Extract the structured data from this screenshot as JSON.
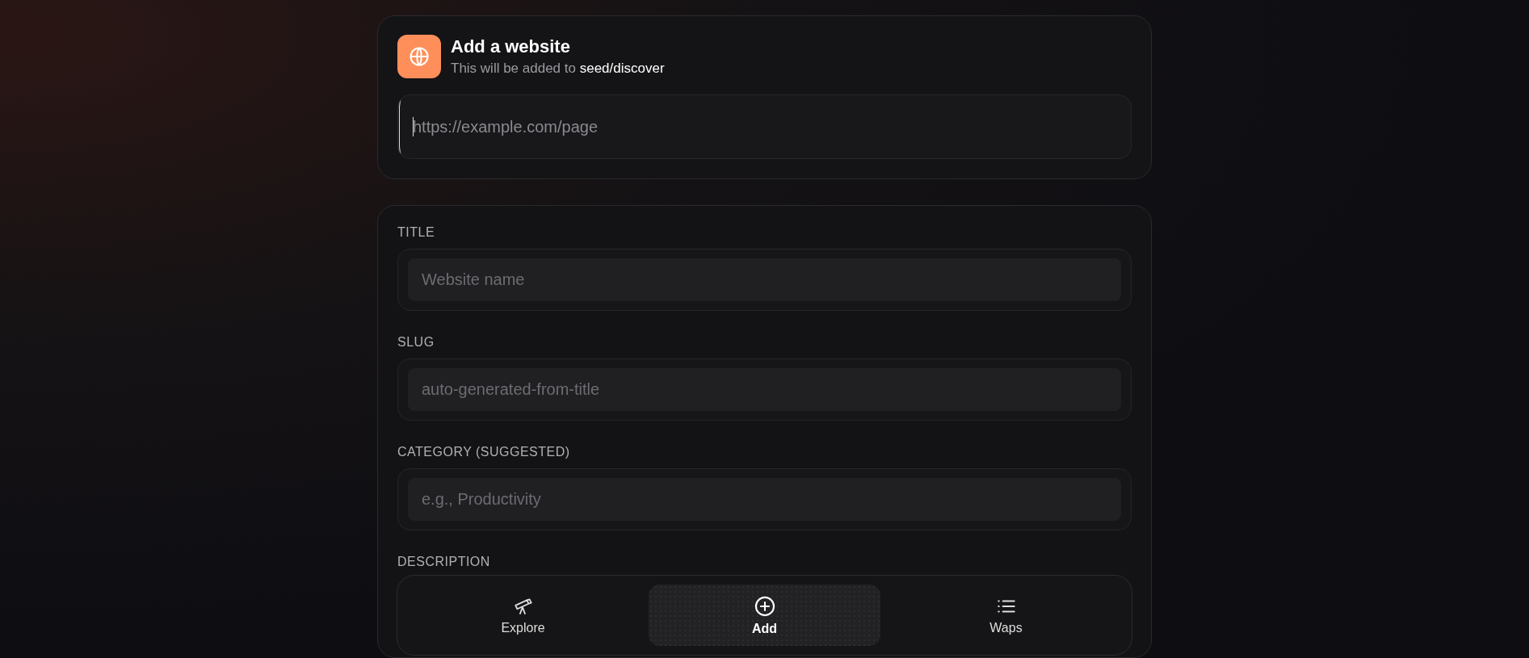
{
  "header": {
    "title": "Add a website",
    "subtitle": "This will be added to **seed/discover**"
  },
  "url_field": {
    "placeholder": "https://example.com/page",
    "focused": true
  },
  "fields": [
    {
      "label": "TITLE",
      "placeholder": "Website name"
    },
    {
      "label": "SLUG",
      "placeholder": "auto-generated-from-title"
    },
    {
      "label": "CATEGORY (SUGGESTED)",
      "placeholder": "e.g., Productivity"
    },
    {
      "label": "DESCRIPTION"
    }
  ],
  "nav": [
    {
      "kind": "telescope",
      "label": "Explore",
      "selected": false
    },
    {
      "kind": "add",
      "label": "Add",
      "selected": true
    },
    {
      "kind": "list",
      "label": "Waps",
      "selected": false
    }
  ]
}
